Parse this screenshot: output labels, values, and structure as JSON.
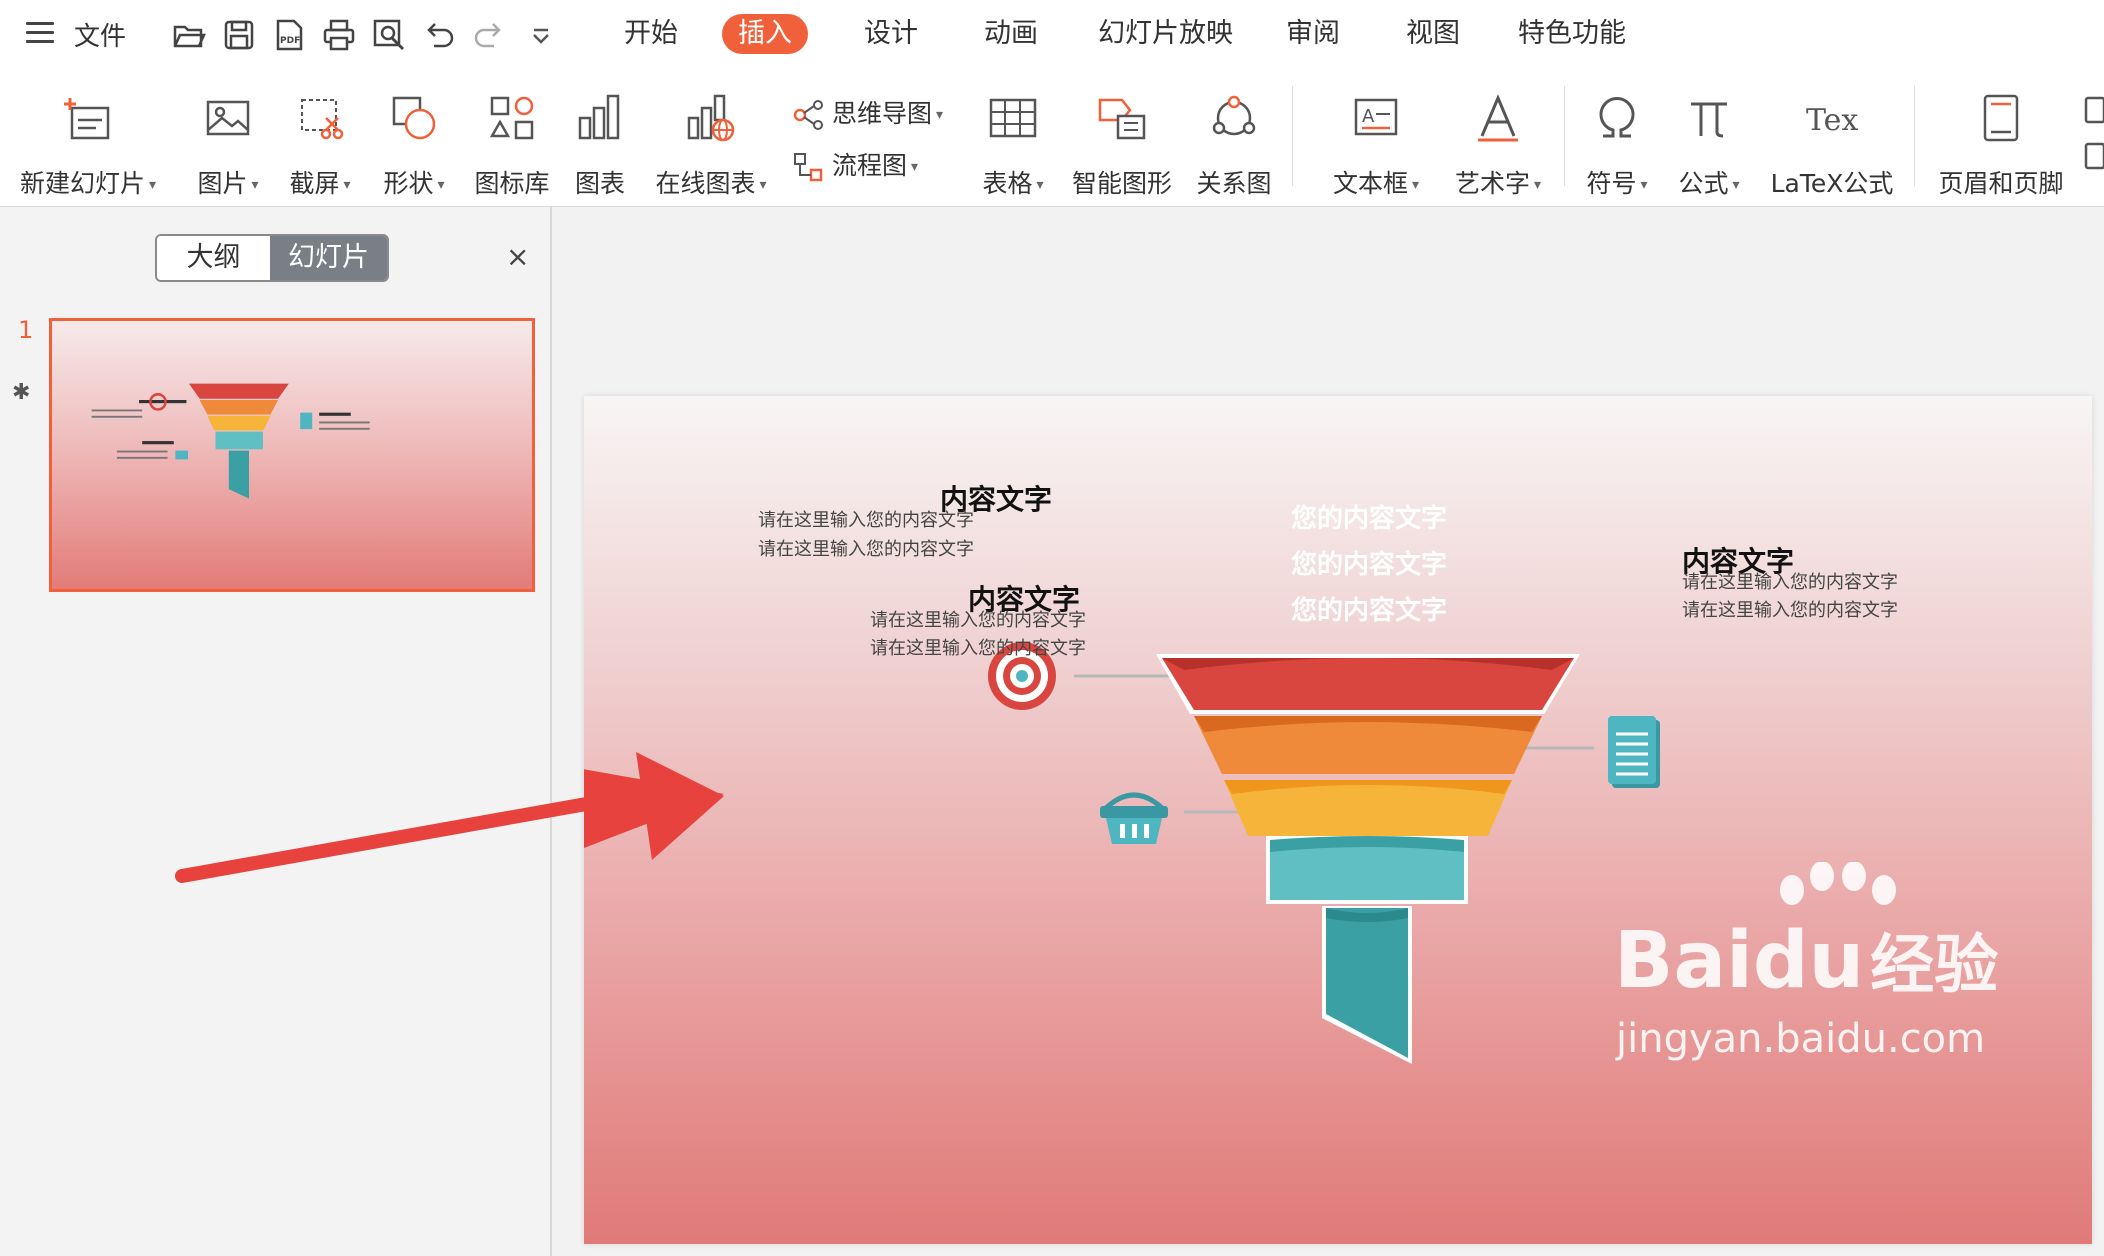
{
  "menubar": {
    "file_label": "文件",
    "tabs": [
      {
        "label": "开始",
        "active": false
      },
      {
        "label": "插入",
        "active": true
      },
      {
        "label": "设计",
        "active": false
      },
      {
        "label": "动画",
        "active": false
      },
      {
        "label": "幻灯片放映",
        "active": false
      },
      {
        "label": "审阅",
        "active": false
      },
      {
        "label": "视图",
        "active": false
      },
      {
        "label": "特色功能",
        "active": false
      }
    ],
    "quick_icons": [
      "folder-open-icon",
      "save-icon",
      "pdf-icon",
      "print-icon",
      "print-preview-icon",
      "undo-icon",
      "redo-icon",
      "customize-dropdown-icon"
    ]
  },
  "ribbon": {
    "new_slide": "新建幻灯片",
    "picture": "图片",
    "screenshot": "截屏",
    "shape": "形状",
    "icon_library": "图标库",
    "chart": "图表",
    "online_chart": "在线图表",
    "mindmap": "思维导图",
    "flowchart": "流程图",
    "table": "表格",
    "smart_art": "智能图形",
    "relation": "关系图",
    "textbox": "文本框",
    "wordart": "艺术字",
    "symbol": "符号",
    "formula": "公式",
    "latex": "LaTeX公式",
    "header_footer": "页眉和页脚",
    "caret": "▾"
  },
  "left_panel": {
    "outline_tab": "大纲",
    "slides_tab": "幻灯片",
    "close": "×",
    "slide_number": "1"
  },
  "slide": {
    "left_top": {
      "title": "内容文字",
      "line1": "请在这里输入您的内容文字",
      "line2": "请在这里输入您的内容文字"
    },
    "left_bottom": {
      "title": "内容文字",
      "line1": "请在这里输入您的内容文字",
      "line2": "请在这里输入您的内容文字"
    },
    "right": {
      "title": "内容文字",
      "line1": "请在这里输入您的内容文字",
      "line2": "请在这里输入您的内容文字"
    },
    "funnel": [
      "您的内容文字",
      "您的内容文字",
      "您的内容文字"
    ]
  },
  "watermark": {
    "brand": "Bai",
    "brand2": "du",
    "cn": "经验",
    "url": "jingyan.baidu.com"
  },
  "colors": {
    "accent": "#f0603a",
    "funnel_red": "#d9463f",
    "funnel_orange": "#ee8a3a",
    "funnel_yellow": "#f7b43a",
    "funnel_teal": "#5fbfc2",
    "arrow_red": "#e8423f"
  }
}
